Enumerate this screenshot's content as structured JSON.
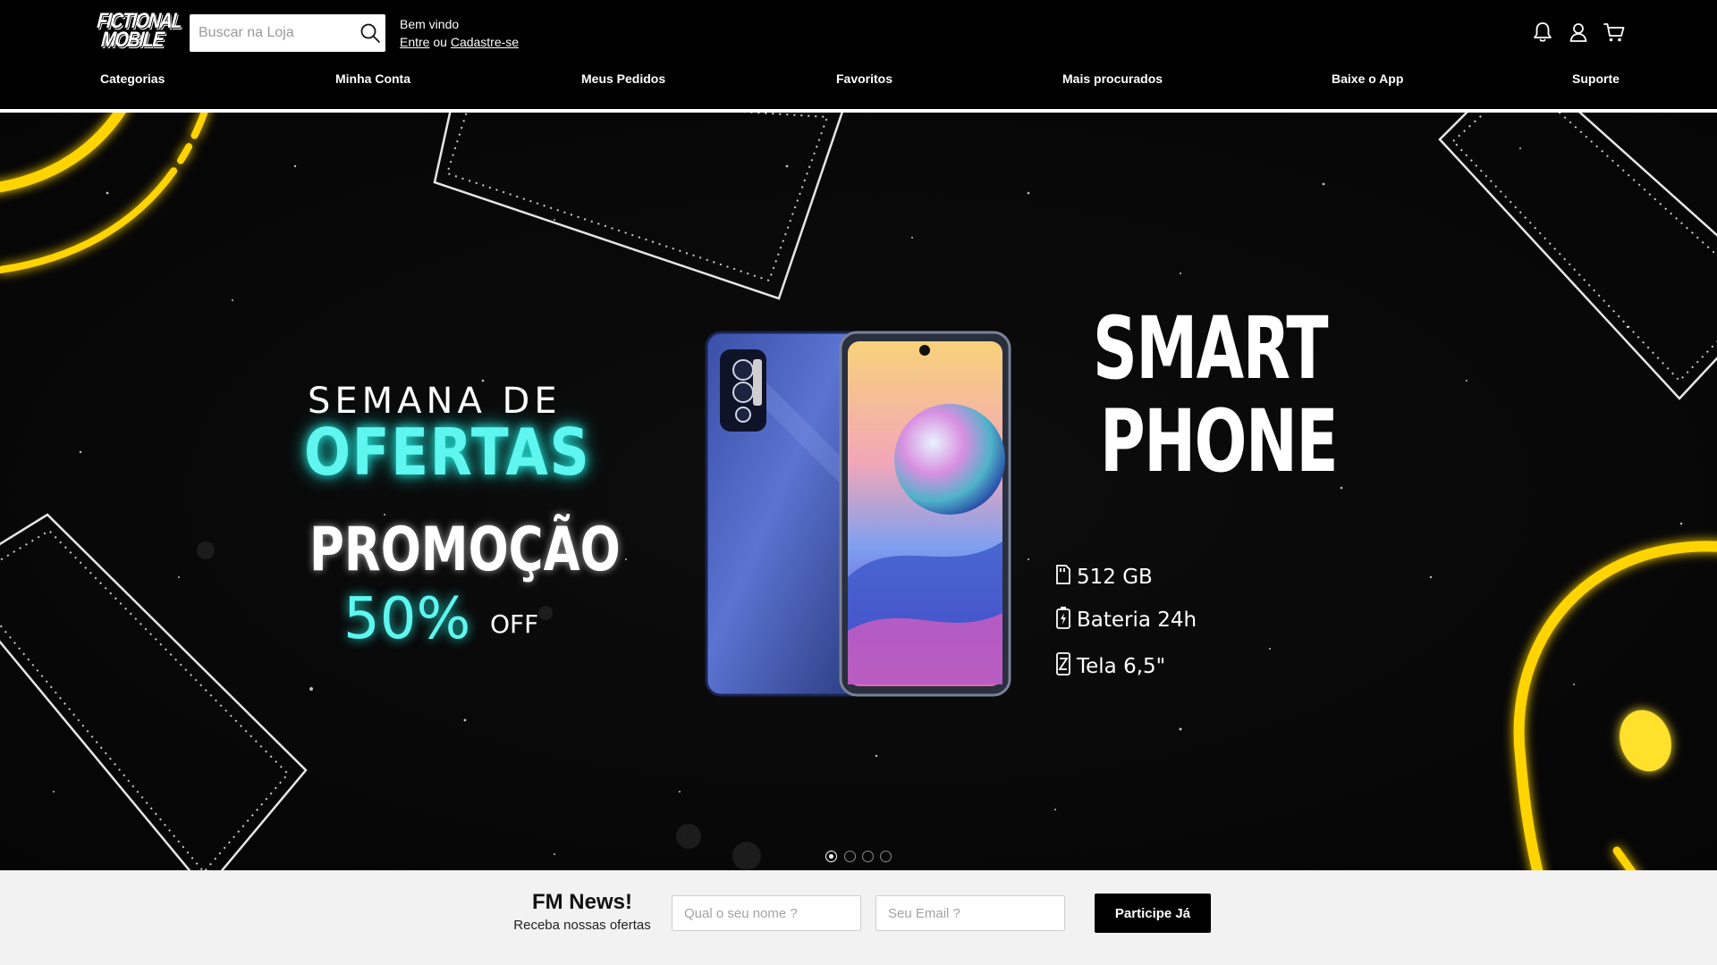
{
  "brand": {
    "logo_line1": "FICTIONAL",
    "logo_line2": "MOBILE"
  },
  "search": {
    "placeholder": "Buscar na Loja",
    "value": "",
    "icon": "search-icon"
  },
  "welcome": {
    "greeting": "Bem vindo",
    "login": "Entre",
    "or": "ou",
    "register": "Cadastre-se"
  },
  "header_icons": [
    "bell-icon",
    "user-icon",
    "cart-icon"
  ],
  "nav": {
    "items": [
      {
        "label": "Categorias"
      },
      {
        "label": "Minha Conta"
      },
      {
        "label": "Meus Pedidos"
      },
      {
        "label": "Favoritos"
      },
      {
        "label": "Mais procurados"
      },
      {
        "label": "Baixe o App"
      },
      {
        "label": "Suporte"
      }
    ]
  },
  "hero": {
    "promo": {
      "line1": "SEMANA DE",
      "line2": "OFERTAS",
      "line3": "PROMOÇÃO",
      "discount": "50%",
      "off": "OFF"
    },
    "product": {
      "title_line1": "SMART",
      "title_line2": "PHONE",
      "specs": [
        {
          "icon": "memory-card-icon",
          "text": "512 GB"
        },
        {
          "icon": "battery-icon",
          "text": "Bateria 24h"
        },
        {
          "icon": "screen-size-icon",
          "text": "Tela 6,5\""
        }
      ]
    },
    "carousel": {
      "slides": 4,
      "active": 1
    }
  },
  "newsletter": {
    "title": "FM News!",
    "subtitle": "Receba nossas ofertas",
    "name_placeholder": "Qual o seu nome ?",
    "email_placeholder": "Seu Email ?",
    "button": "Participe Já"
  },
  "colors": {
    "header_bg": "#000000",
    "accent_cyan": "#5ff6ef",
    "neon_yellow": "#ffd400",
    "newsletter_bg": "#f2f2f2"
  }
}
